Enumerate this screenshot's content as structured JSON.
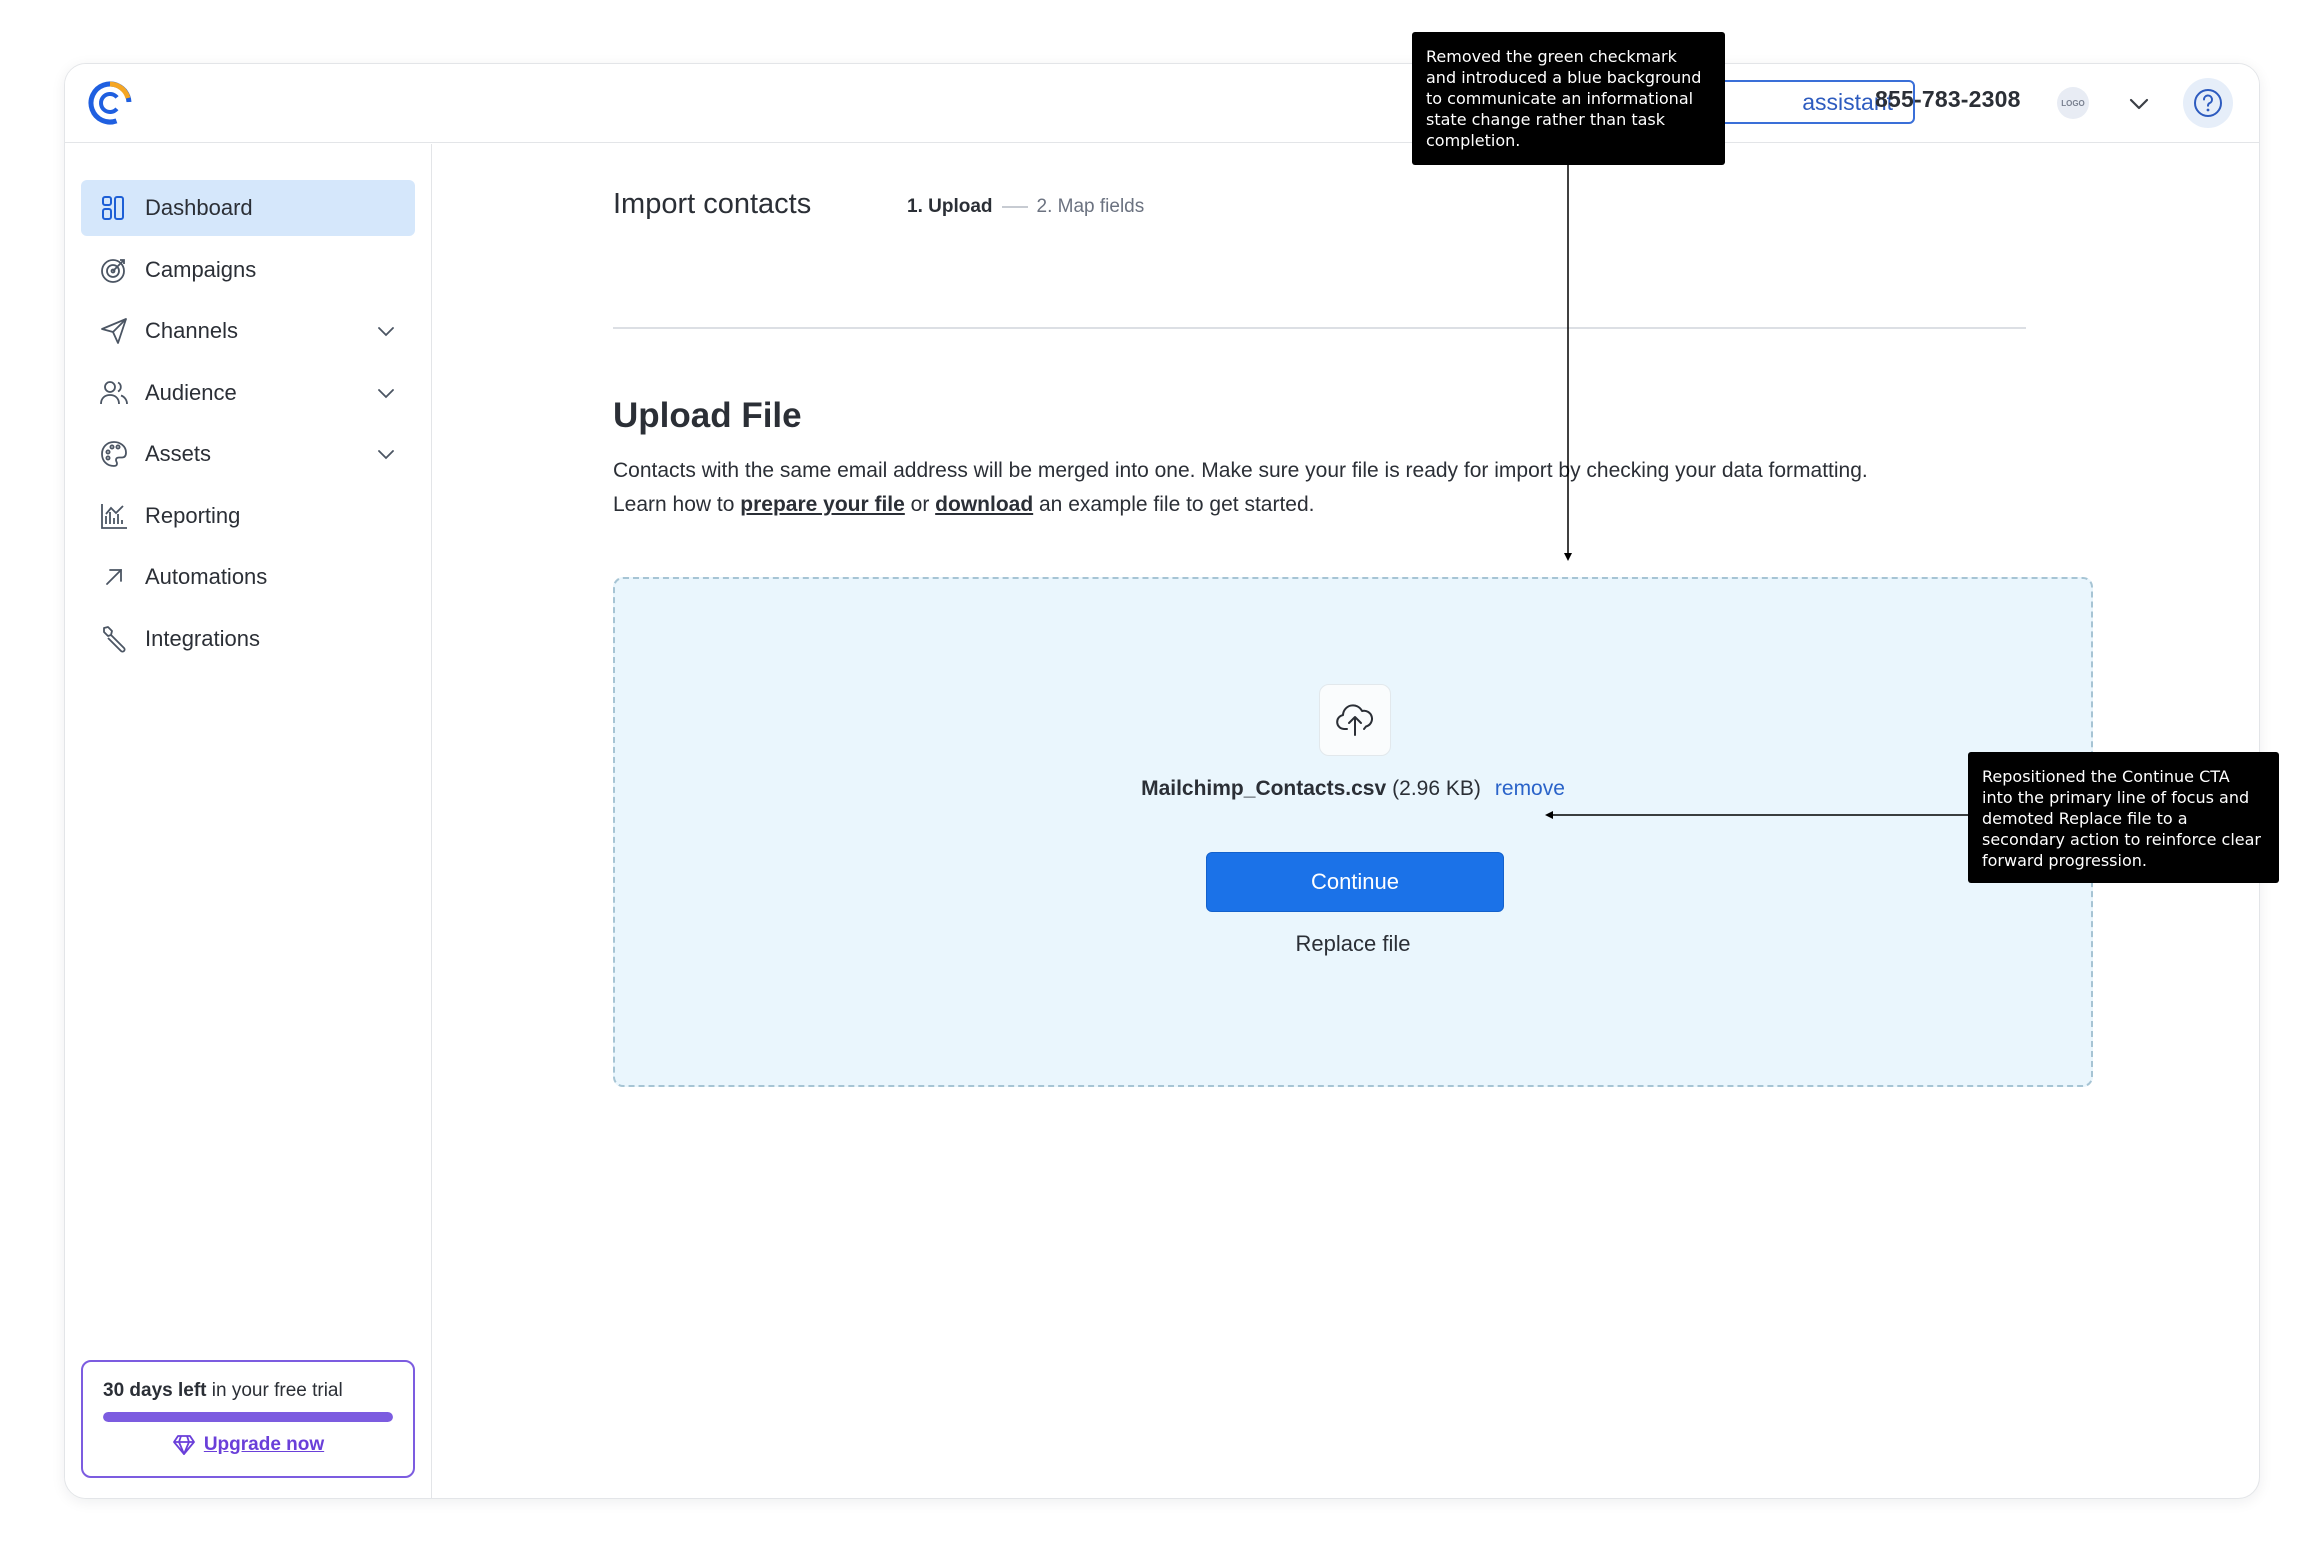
{
  "header": {
    "assistant_label": "assistant",
    "phone": "855-783-2308",
    "avatar_text": "LOGO"
  },
  "sidebar": {
    "items": [
      {
        "label": "Dashboard",
        "icon": "dashboard-icon",
        "active": true
      },
      {
        "label": "Campaigns",
        "icon": "target-icon"
      },
      {
        "label": "Channels",
        "icon": "send-icon",
        "expandable": true
      },
      {
        "label": "Audience",
        "icon": "people-icon",
        "expandable": true
      },
      {
        "label": "Assets",
        "icon": "palette-icon",
        "expandable": true
      },
      {
        "label": "Reporting",
        "icon": "chart-icon"
      },
      {
        "label": "Automations",
        "icon": "arrow-up-right-icon"
      },
      {
        "label": "Integrations",
        "icon": "wrench-icon"
      }
    ],
    "trial": {
      "days_left": "30 days left",
      "rest": " in your free trial",
      "progress": 1.0,
      "upgrade_label": "Upgrade now"
    }
  },
  "main": {
    "page_title": "Import contacts",
    "steps": [
      "1. Upload",
      "2. Map fields"
    ],
    "section_title": "Upload File",
    "desc_line1": "Contacts with the same email address will be merged into one. Make sure your file is ready for import by checking your data formatting.",
    "desc_pre": "Learn how to ",
    "desc_link1": "prepare your file",
    "desc_mid": " or ",
    "desc_link2": "download",
    "desc_post": " an example file to get started.",
    "upload": {
      "file_name": "Mailchimp_Contacts.csv",
      "file_size": "(2.96 KB)",
      "remove_label": "remove",
      "continue_label": "Continue",
      "replace_label": "Replace file"
    }
  },
  "annotations": {
    "note_1": "Removed the green checkmark and introduced a blue background to communicate an informational state change rather than task completion.",
    "note_2": "Repositioned the Continue CTA into the primary line of focus and demoted Replace file to a secondary action to reinforce clear forward progression."
  },
  "colors": {
    "brand_blue": "#1b72e8",
    "brand_orange": "#f5a623",
    "active_nav_bg": "#d5e7fb",
    "dropzone_bg": "#eaf6fd",
    "trial_purple": "#7c5ce0"
  }
}
